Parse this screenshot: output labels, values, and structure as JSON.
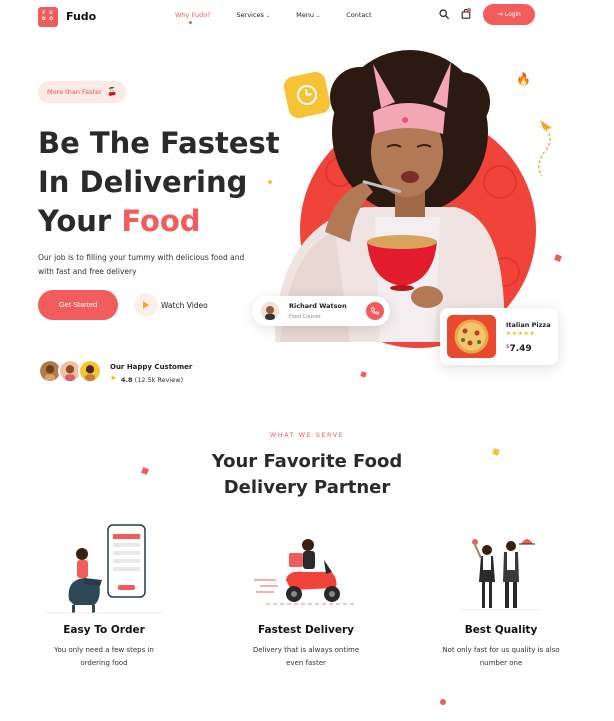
{
  "brand": {
    "logo_mark": "FU DO",
    "name": "Fudo"
  },
  "nav": {
    "items": [
      {
        "label": "Why Fudo?"
      },
      {
        "label": "Services"
      },
      {
        "label": "Menu"
      },
      {
        "label": "Contact"
      }
    ],
    "login_label": "Login"
  },
  "hero": {
    "pill": "More than Faster",
    "title_line1": "Be The Fastest",
    "title_line2": "In Delivering",
    "title_line3_a": "Your ",
    "title_line3_b": "Food",
    "description": "Our job is to filling your tummy with delicious food and  with fast and free delivery",
    "cta_label": "Get Started",
    "watch_label": "Watch Video",
    "customers_title": "Our Happy Customer",
    "rating": "4.8",
    "reviews": "(12.5k Review)"
  },
  "courier": {
    "name": "Richard Watson",
    "role": "Food Courier"
  },
  "pizza": {
    "name": "Italian Pizza",
    "stars": "★★★★★",
    "currency": "$",
    "price": "7.49"
  },
  "section": {
    "eyebrow": "WHAT WE SERVE",
    "title_line1": "Your Favorite Food",
    "title_line2": "Delivery Partner"
  },
  "features": [
    {
      "title": "Easy To Order",
      "desc_line1": "You only need a few steps in",
      "desc_line2": "ordering food"
    },
    {
      "title": "Fastest Delivery",
      "desc_line1": "Delivery that is always ontime",
      "desc_line2": "even faster"
    },
    {
      "title": "Best Quality",
      "desc_line1": "Not only fast for us quality is also",
      "desc_line2": "number one"
    }
  ],
  "colors": {
    "accent": "#f25c5c",
    "yellow": "#f7c234",
    "text": "#2a2a2a"
  }
}
